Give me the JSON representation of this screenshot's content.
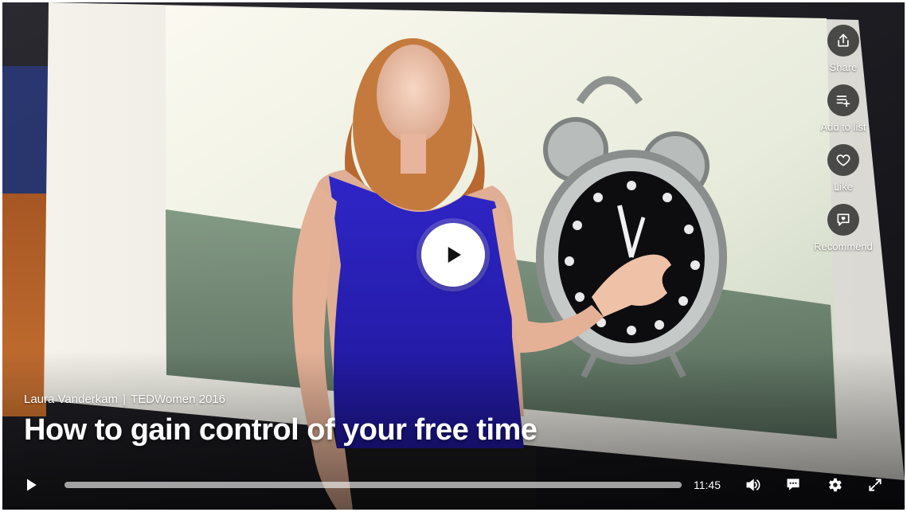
{
  "video": {
    "speaker": "Laura Vanderkam",
    "event": "TEDWomen 2016",
    "title": "How to gain control of your free time",
    "duration": "11:45",
    "progress": 0
  },
  "actions": [
    {
      "label": "Share",
      "icon": "share-icon"
    },
    {
      "label": "Add to list",
      "icon": "add-to-list-icon"
    },
    {
      "label": "Like",
      "icon": "heart-icon"
    },
    {
      "label": "Recommend",
      "icon": "recommend-icon"
    }
  ],
  "colors": {
    "accent": "#e62b1e",
    "dress": "#2a1fb0"
  }
}
